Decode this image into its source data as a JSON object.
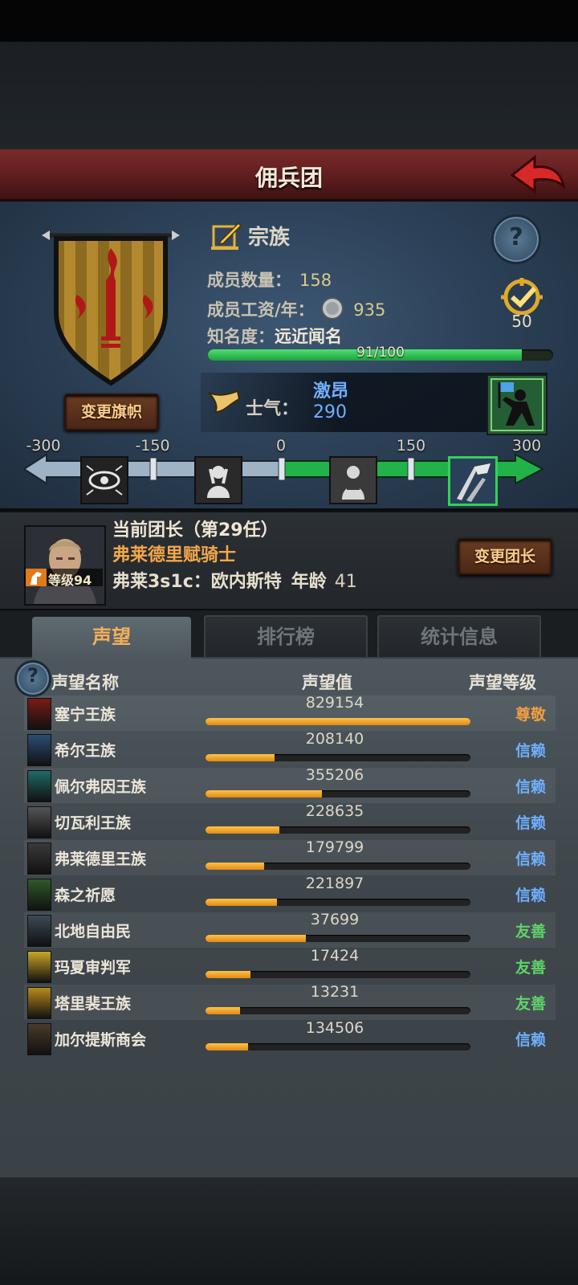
{
  "header": {
    "title": "佣兵团"
  },
  "clan": {
    "type_label": "宗族",
    "members_label": "成员数量：",
    "members_value": "158",
    "wage_label": "成员工资/年：",
    "wage_value": "935",
    "fame_label": "知名度：",
    "fame_value": "远近闻名",
    "fame_progress_text": "91/100",
    "fame_progress": 0.91,
    "rating_value": "50",
    "change_flag_label": "变更旗帜"
  },
  "morale": {
    "label": "士气：",
    "state": "激昂",
    "value": "290",
    "scale_ticks": [
      "-300",
      "-150",
      "0",
      "150",
      "300"
    ],
    "scale_value": 290
  },
  "leader": {
    "title": "当前团长（第29任）",
    "name": "弗莱德里赋骑士",
    "origin_label": "弗莱3s1c：欧内斯特",
    "age_label": "年龄",
    "age_value": "41",
    "level_label": "等级94",
    "change_leader_label": "变更团长"
  },
  "tabs": [
    "声望",
    "排行榜",
    "统计信息"
  ],
  "reputation": {
    "headers": {
      "name": "声望名称",
      "value": "声望值",
      "level": "声望等级"
    },
    "rows": [
      {
        "name": "塞宁王族",
        "value": "829154",
        "level": "尊敬",
        "progress": 1.0,
        "level_color": "#f0a040",
        "crest_color": "#7a1a16"
      },
      {
        "name": "希尔王族",
        "value": "208140",
        "level": "信赖",
        "progress": 0.26,
        "level_color": "#6fb0ff",
        "crest_color": "#2a4d73"
      },
      {
        "name": "佩尔弗因王族",
        "value": "355206",
        "level": "信赖",
        "progress": 0.44,
        "level_color": "#6fb0ff",
        "crest_color": "#1e6a66"
      },
      {
        "name": "切瓦利王族",
        "value": "228635",
        "level": "信赖",
        "progress": 0.28,
        "level_color": "#6fb0ff",
        "crest_color": "#555555"
      },
      {
        "name": "弗莱德里王族",
        "value": "179799",
        "level": "信赖",
        "progress": 0.22,
        "level_color": "#6fb0ff",
        "crest_color": "#3a3a3a"
      },
      {
        "name": "森之祈愿",
        "value": "221897",
        "level": "信赖",
        "progress": 0.27,
        "level_color": "#6fb0ff",
        "crest_color": "#2f5a2a"
      },
      {
        "name": "北地自由民",
        "value": "37699",
        "level": "友善",
        "progress": 0.38,
        "level_color": "#5fd36a",
        "crest_color": "#3a4a55"
      },
      {
        "name": "玛夏审判军",
        "value": "17424",
        "level": "友善",
        "progress": 0.17,
        "level_color": "#5fd36a",
        "crest_color": "#c9a526"
      },
      {
        "name": "塔里裴王族",
        "value": "13231",
        "level": "友善",
        "progress": 0.13,
        "level_color": "#5fd36a",
        "crest_color": "#b88a1a"
      },
      {
        "name": "加尔提斯商会",
        "value": "134506",
        "level": "信赖",
        "progress": 0.16,
        "level_color": "#6fb0ff",
        "crest_color": "#4a3a2a"
      }
    ]
  }
}
